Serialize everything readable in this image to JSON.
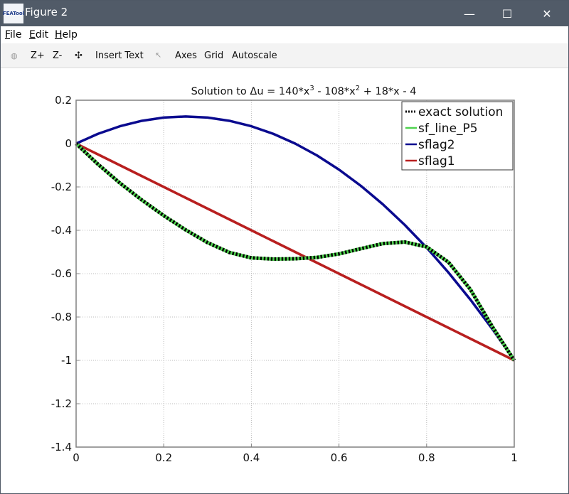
{
  "window": {
    "title": "Figure 2",
    "app_icon_text": "FEATool",
    "controls": {
      "minimize": "—",
      "maximize": "☐",
      "close": "✕"
    }
  },
  "menubar": {
    "items": [
      {
        "label": "File",
        "mnemonic": "F",
        "rest": "ile"
      },
      {
        "label": "Edit",
        "mnemonic": "E",
        "rest": "dit"
      },
      {
        "label": "Help",
        "mnemonic": "H",
        "rest": "elp"
      }
    ]
  },
  "toolbar": {
    "rotate_icon": "◍",
    "zoom_in": "Z+",
    "zoom_out": "Z-",
    "pan_icon": "✣",
    "insert_text": "Insert Text",
    "select_icon": "↖",
    "axes": "Axes",
    "grid": "Grid",
    "autoscale": "Autoscale"
  },
  "colors": {
    "exact": "#000000",
    "exact_under": "#3fbf3f",
    "sf_line_P5": "#4fd24f",
    "sflag2": "#0a0a8f",
    "sflag1": "#b81f1f",
    "titlebar": "#515b68"
  },
  "chart_data": {
    "type": "line",
    "title": "Solution to Δu = 140*x^3 - 108*x^2 + 18*x - 4",
    "title_parts": [
      "Solution to Δu = 140*x",
      "3",
      " - 108*x",
      "2",
      " + 18*x - 4"
    ],
    "xlabel": "",
    "ylabel": "",
    "xlim": [
      0,
      1
    ],
    "ylim": [
      -1.4,
      0.2
    ],
    "xticks": [
      0,
      0.2,
      0.4,
      0.6,
      0.8,
      1
    ],
    "xtick_labels": [
      "0",
      "0.2",
      "0.4",
      "0.6",
      "0.8",
      "1"
    ],
    "yticks": [
      0.2,
      0,
      -0.2,
      -0.4,
      -0.6,
      -0.8,
      -1,
      -1.2,
      -1.4
    ],
    "ytick_labels": [
      "0.2",
      "0",
      "-0.2",
      "-0.4",
      "-0.6",
      "-0.8",
      "-1",
      "-1.2",
      "-1.4"
    ],
    "grid": true,
    "legend_position": "top-right",
    "x": [
      0,
      0.05,
      0.1,
      0.15,
      0.2,
      0.25,
      0.3,
      0.35,
      0.4,
      0.45,
      0.5,
      0.55,
      0.6,
      0.65,
      0.7,
      0.75,
      0.8,
      0.85,
      0.9,
      0.95,
      1
    ],
    "series": [
      {
        "name": "exact solution",
        "style": "dotted",
        "values": [
          0,
          -0.0955,
          -0.1821,
          -0.2603,
          -0.3322,
          -0.3979,
          -0.4568,
          -0.5022,
          -0.5271,
          -0.5326,
          -0.5313,
          -0.525,
          -0.5089,
          -0.4847,
          -0.4613,
          -0.4541,
          -0.4764,
          -0.5473,
          -0.6732,
          -0.8444,
          -1
        ]
      },
      {
        "name": "sf_line_P5",
        "style": "solid",
        "values": [
          0,
          -0.0955,
          -0.1821,
          -0.2603,
          -0.3322,
          -0.3979,
          -0.4568,
          -0.5022,
          -0.5271,
          -0.5326,
          -0.5313,
          -0.525,
          -0.5089,
          -0.4847,
          -0.4613,
          -0.4541,
          -0.4764,
          -0.5473,
          -0.6732,
          -0.8444,
          -1
        ]
      },
      {
        "name": "sflag2",
        "style": "solid",
        "values": [
          0,
          0.045,
          0.08,
          0.105,
          0.12,
          0.125,
          0.12,
          0.105,
          0.08,
          0.045,
          0,
          -0.055,
          -0.12,
          -0.195,
          -0.28,
          -0.375,
          -0.48,
          -0.595,
          -0.72,
          -0.855,
          -1
        ]
      },
      {
        "name": "sflag1",
        "style": "solid",
        "values": [
          0,
          -0.05,
          -0.1,
          -0.15,
          -0.2,
          -0.25,
          -0.3,
          -0.35,
          -0.4,
          -0.45,
          -0.5,
          -0.55,
          -0.6,
          -0.65,
          -0.7,
          -0.75,
          -0.8,
          -0.85,
          -0.9,
          -0.95,
          -1
        ]
      }
    ]
  }
}
